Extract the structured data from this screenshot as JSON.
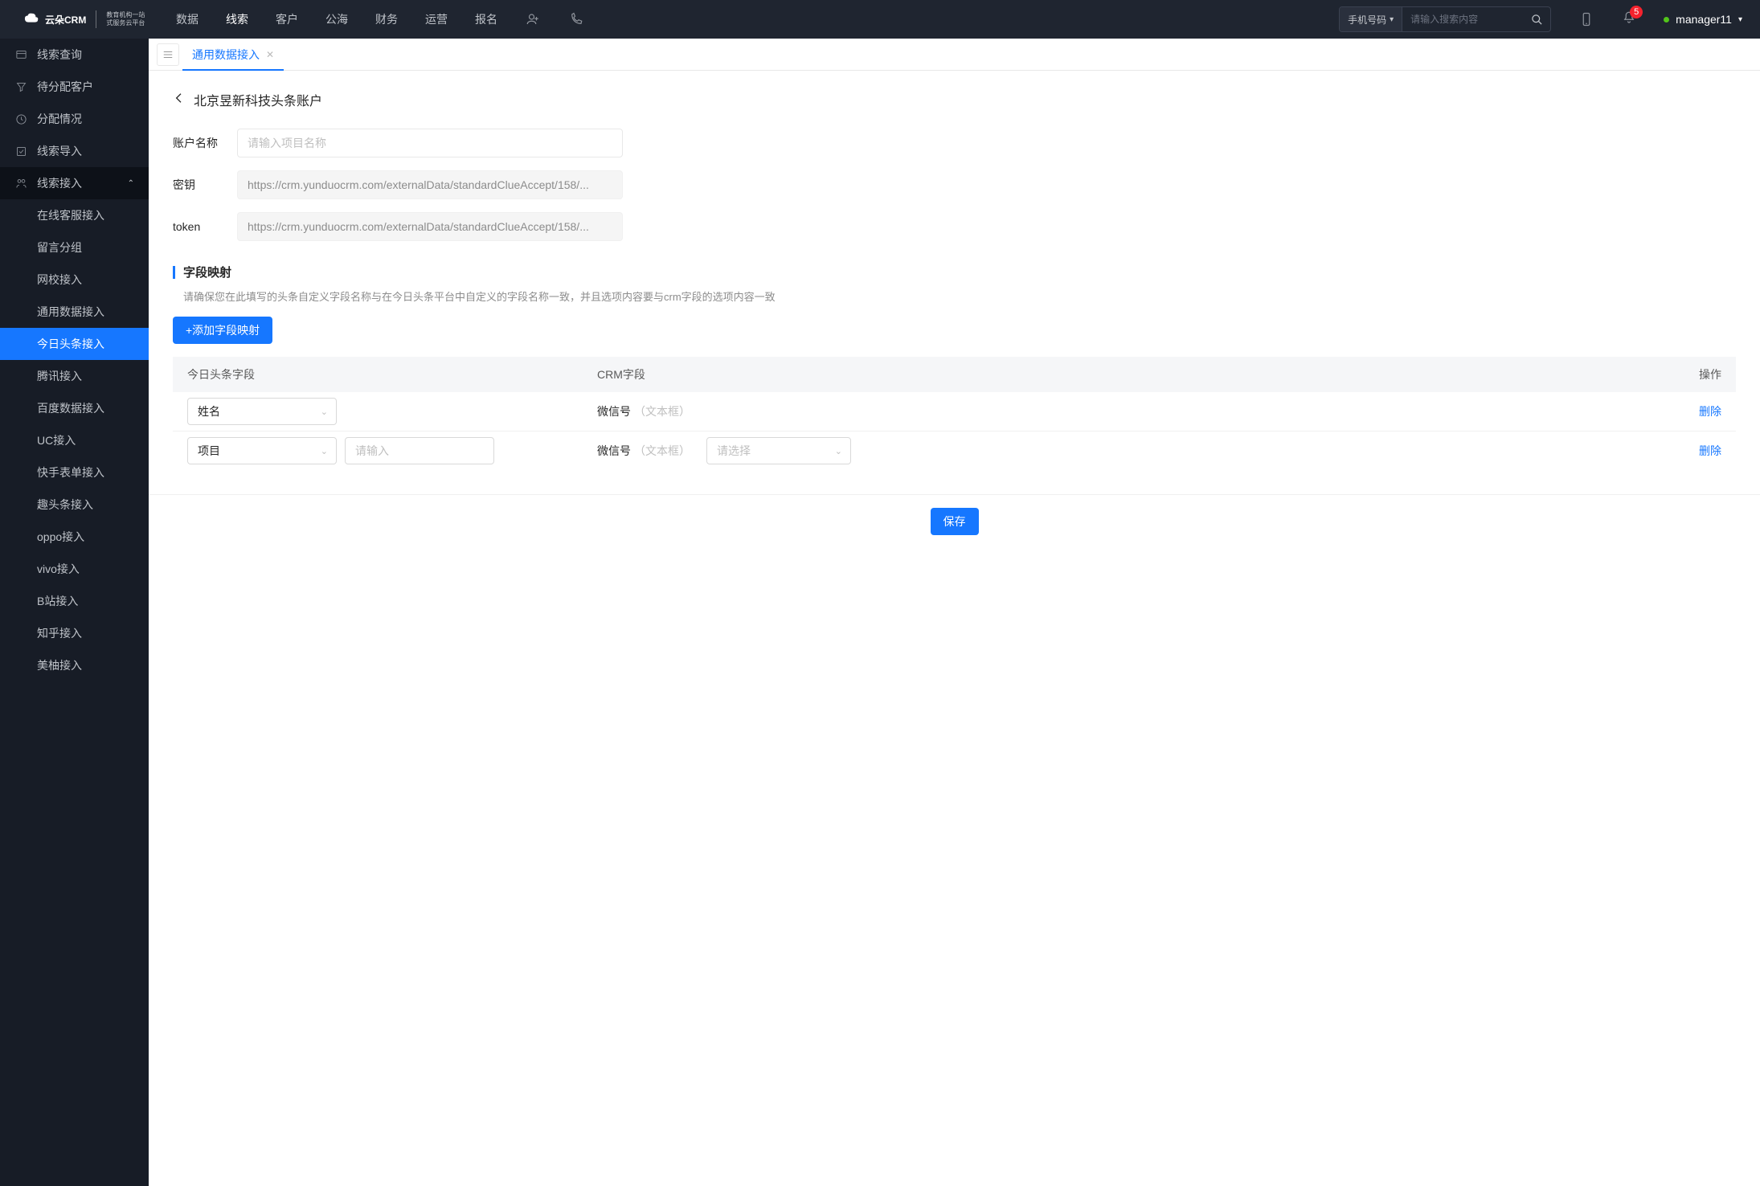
{
  "header": {
    "logo_brand": "云朵CRM",
    "logo_sub_line1": "教育机构一站",
    "logo_sub_line2": "式服务云平台",
    "nav": [
      "数据",
      "线索",
      "客户",
      "公海",
      "财务",
      "运营",
      "报名"
    ],
    "nav_active_index": 1,
    "search_select": "手机号码",
    "search_placeholder": "请输入搜索内容",
    "badge_count": "5",
    "username": "manager11"
  },
  "sidebar": {
    "items": [
      {
        "label": "线索查询"
      },
      {
        "label": "待分配客户"
      },
      {
        "label": "分配情况"
      },
      {
        "label": "线索导入"
      },
      {
        "label": "线索接入",
        "expanded": true,
        "children": [
          "在线客服接入",
          "留言分组",
          "网校接入",
          "通用数据接入",
          "今日头条接入",
          "腾讯接入",
          "百度数据接入",
          "UC接入",
          "快手表单接入",
          "趣头条接入",
          "oppo接入",
          "vivo接入",
          "B站接入",
          "知乎接入",
          "美柚接入"
        ],
        "active_child_index": 4
      }
    ]
  },
  "tabs": {
    "items": [
      "通用数据接入"
    ],
    "active_index": 0
  },
  "page": {
    "title": "北京昱新科技头条账户",
    "form": {
      "account_name_label": "账户名称",
      "account_name_placeholder": "请输入项目名称",
      "secret_label": "密钥",
      "secret_value": "https://crm.yunduocrm.com/externalData/standardClueAccept/158/...",
      "token_label": "token",
      "token_value": "https://crm.yunduocrm.com/externalData/standardClueAccept/158/..."
    },
    "mapping": {
      "section_title": "字段映射",
      "hint": "请确保您在此填写的头条自定义字段名称与在今日头条平台中自定义的字段名称一致，并且选项内容要与crm字段的选项内容一致",
      "add_button": "+添加字段映射",
      "columns": {
        "c1": "今日头条字段",
        "c2": "CRM字段",
        "c3": "操作"
      },
      "rows": [
        {
          "toutiao_select": "姓名",
          "toutiao_has_input": false,
          "crm_label": "微信号",
          "crm_type": "（文本框）",
          "crm_has_select": false,
          "action": "删除"
        },
        {
          "toutiao_select": "项目",
          "toutiao_has_input": true,
          "toutiao_input_placeholder": "请输入",
          "crm_label": "微信号",
          "crm_type": "（文本框）",
          "crm_has_select": true,
          "crm_select_placeholder": "请选择",
          "action": "删除"
        }
      ]
    },
    "save_button": "保存"
  }
}
